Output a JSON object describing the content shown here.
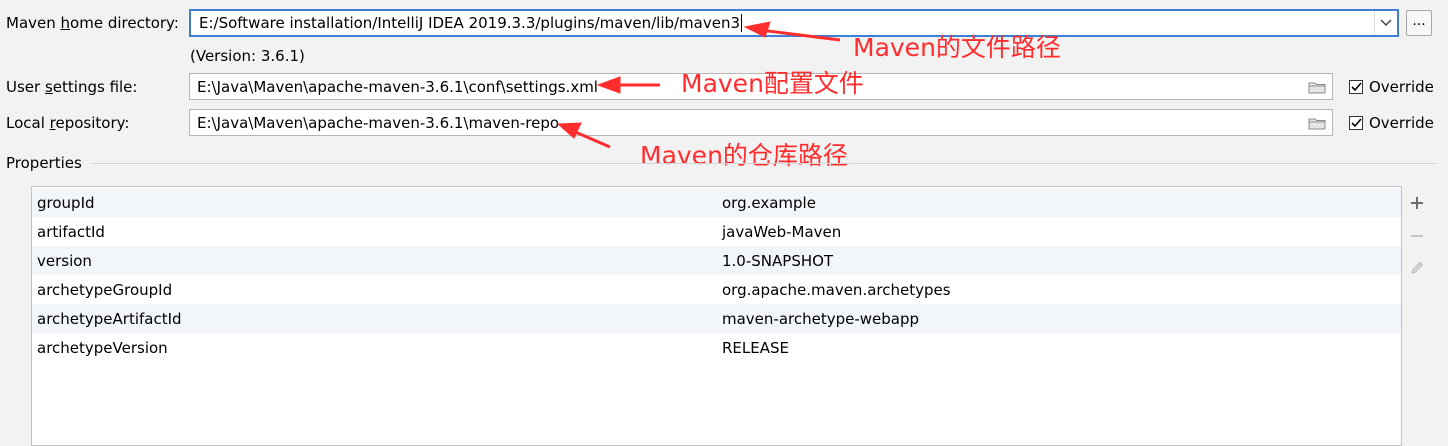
{
  "maven_home": {
    "label_pre": "Maven ",
    "label_mnemonic": "h",
    "label_post": "ome directory:",
    "value": "E:/Software installation/IntelliJ IDEA 2019.3.3/plugins/maven/lib/maven3",
    "version_text": "(Version: 3.6.1)",
    "browse_label": "..."
  },
  "user_settings": {
    "label_pre": "User ",
    "label_mnemonic": "s",
    "label_post": "ettings file:",
    "value": "E:\\Java\\Maven\\apache-maven-3.6.1\\conf\\settings.xml",
    "override_label": "Override",
    "override_checked": true
  },
  "local_repo": {
    "label_pre": "Local ",
    "label_mnemonic": "r",
    "label_post": "epository:",
    "value": "E:\\Java\\Maven\\apache-maven-3.6.1\\maven-repo",
    "override_label": "Override",
    "override_checked": true
  },
  "annotations": {
    "home": "Maven的文件路径",
    "settings": "Maven配置文件",
    "repo": "Maven的仓库路径"
  },
  "properties": {
    "title": "Properties",
    "rows": [
      {
        "key": "groupId",
        "value": "org.example"
      },
      {
        "key": "artifactId",
        "value": "javaWeb-Maven"
      },
      {
        "key": "version",
        "value": "1.0-SNAPSHOT"
      },
      {
        "key": "archetypeGroupId",
        "value": "org.apache.maven.archetypes"
      },
      {
        "key": "archetypeArtifactId",
        "value": "maven-archetype-webapp"
      },
      {
        "key": "archetypeVersion",
        "value": "RELEASE"
      }
    ]
  },
  "toolbar_icons": [
    "add-icon",
    "remove-icon",
    "edit-icon"
  ],
  "colors": {
    "annotation": "#ff2d2d",
    "focus_border": "#3d7fd5"
  }
}
